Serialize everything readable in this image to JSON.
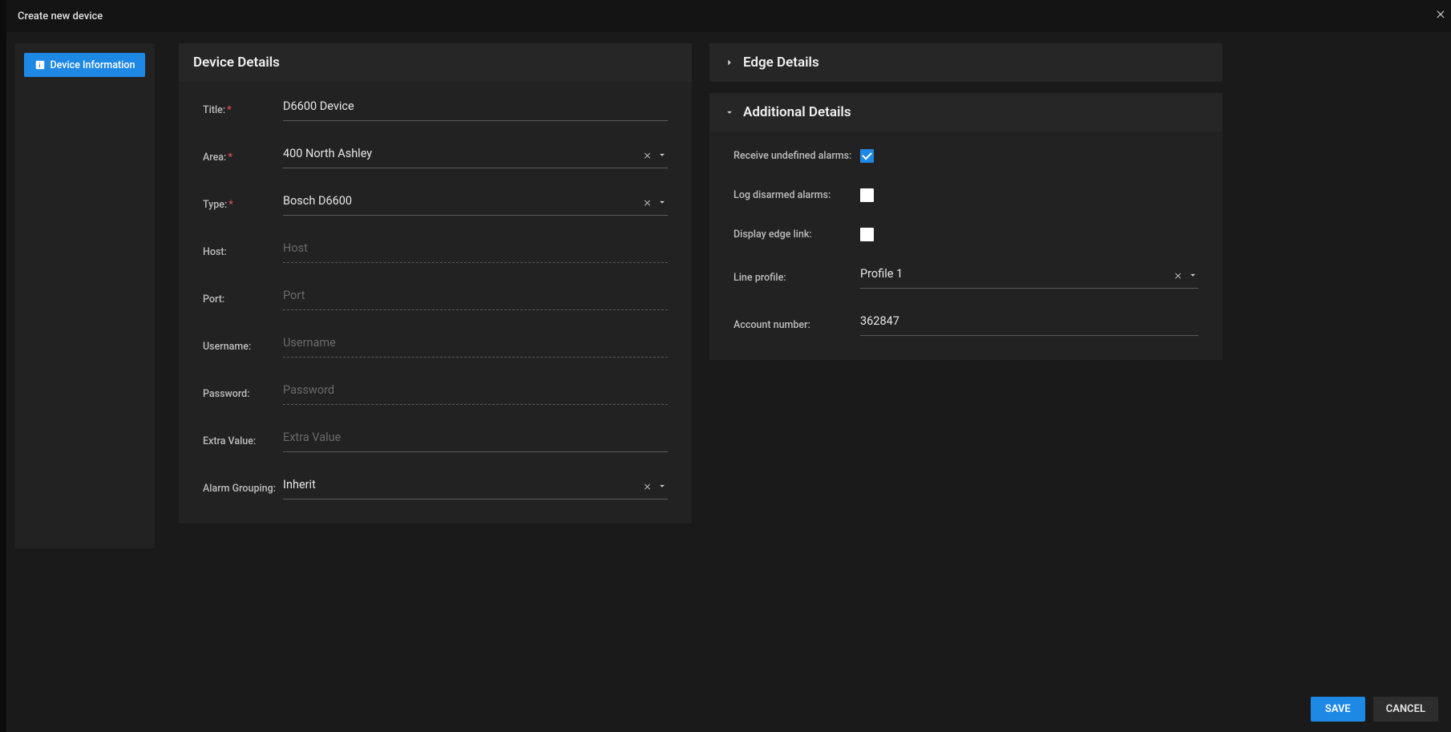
{
  "header": {
    "title": "Create new device"
  },
  "sidebar": {
    "device_info_label": "Device Information"
  },
  "device_details": {
    "title": "Device Details",
    "fields": {
      "title_label": "Title:",
      "title_value": "D6600 Device",
      "area_label": "Area:",
      "area_value": "400 North Ashley",
      "type_label": "Type:",
      "type_value": "Bosch D6600",
      "host_label": "Host:",
      "host_placeholder": "Host",
      "port_label": "Port:",
      "port_placeholder": "Port",
      "username_label": "Username:",
      "username_placeholder": "Username",
      "password_label": "Password:",
      "password_placeholder": "Password",
      "extra_label": "Extra Value:",
      "extra_placeholder": "Extra Value",
      "alarm_grouping_label": "Alarm Grouping:",
      "alarm_grouping_value": "Inherit"
    }
  },
  "edge_details": {
    "title": "Edge Details"
  },
  "additional_details": {
    "title": "Additional Details",
    "receive_label": "Receive undefined alarms:",
    "log_label": "Log disarmed alarms:",
    "display_edge_label": "Display edge link:",
    "line_profile_label": "Line profile:",
    "line_profile_value": "Profile 1",
    "account_label": "Account number:",
    "account_value": "362847"
  },
  "footer": {
    "save": "SAVE",
    "cancel": "CANCEL"
  }
}
